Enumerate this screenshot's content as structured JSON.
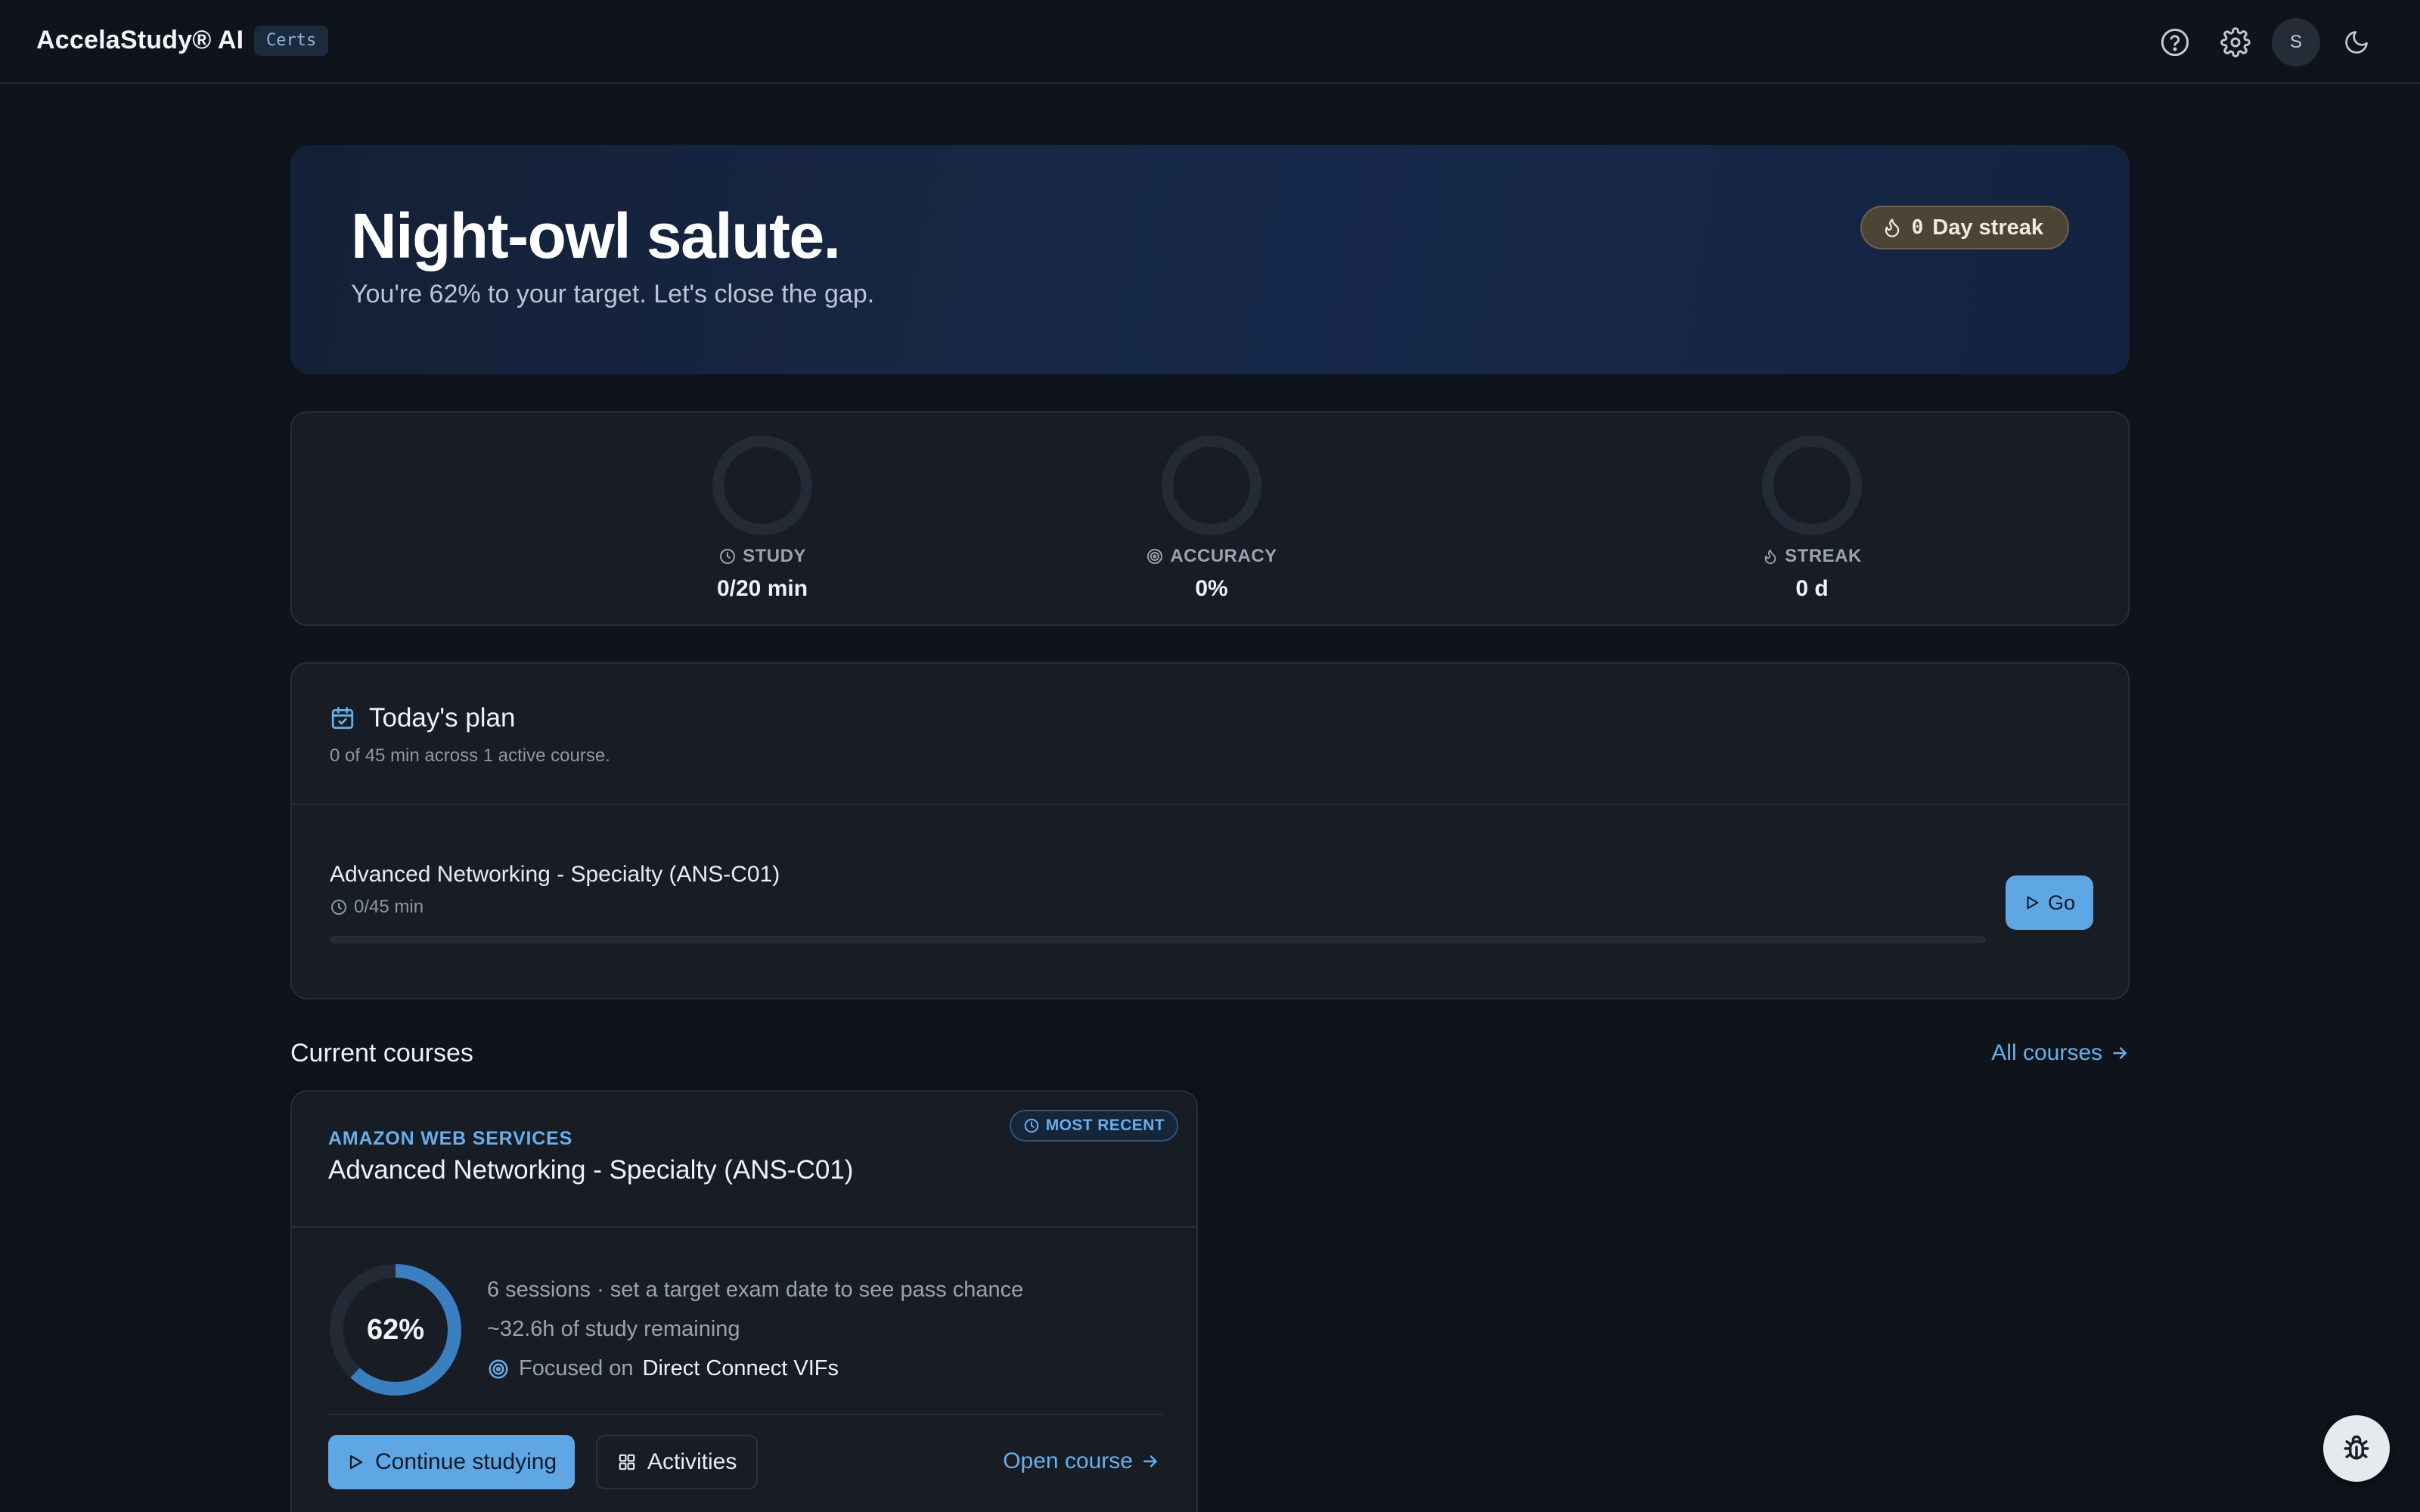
{
  "header": {
    "brand": "AccelaStudy® AI",
    "badge": "Certs",
    "avatar_initial": "S",
    "icons": [
      "help-circle-icon",
      "gear-icon",
      "moon-icon"
    ]
  },
  "hero": {
    "title": "Night-owl salute.",
    "subtitle": "You're 62% to your target. Let's close the gap.",
    "streak_count": "0",
    "streak_label": "Day streak"
  },
  "metrics": [
    {
      "label": "STUDY",
      "value": "0/20 min",
      "icon": "clock-icon"
    },
    {
      "label": "ACCURACY",
      "value": "0%",
      "icon": "target-icon"
    },
    {
      "label": "STREAK",
      "value": "0 d",
      "icon": "flame-icon"
    }
  ],
  "plan": {
    "title": "Today's plan",
    "subtitle": "0 of 45 min across 1 active course.",
    "course": "Advanced Networking - Specialty (ANS-C01)",
    "time": "0/45 min",
    "progress": 0,
    "go_label": "Go"
  },
  "courses": {
    "title": "Current courses",
    "all_link": "All courses",
    "card": {
      "badge": "MOST RECENT",
      "provider": "AMAZON WEB SERVICES",
      "name": "Advanced Networking - Specialty (ANS-C01)",
      "progress_pct": 62,
      "progress_label": "62%",
      "line1": "6 sessions · set a target exam date to see pass chance",
      "line2": "~32.6h of study remaining",
      "focus_prefix": "Focused on",
      "focus_topic": "Direct Connect VIFs",
      "continue_label": "Continue studying",
      "activities_label": "Activities",
      "open_label": "Open course"
    }
  },
  "colors": {
    "accent": "#5fa7e4",
    "link": "#6aaee9",
    "background": "#0f131b",
    "card": "#171c25"
  }
}
